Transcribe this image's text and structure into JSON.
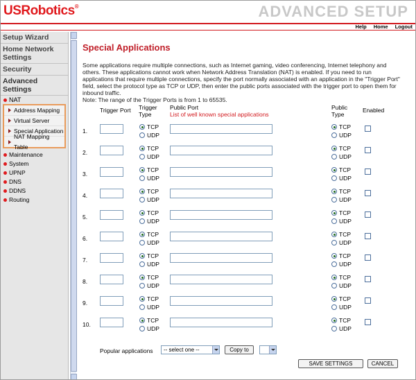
{
  "header": {
    "logo": "USRobotics",
    "logo_mark": "®",
    "title": "ADVANCED SETUP",
    "links": [
      "Help",
      "Home",
      "Logout"
    ]
  },
  "sidebar": {
    "sections": [
      "Setup Wizard",
      "Home Network Settings",
      "Security",
      "Advanced Settings"
    ],
    "nat_label": "NAT",
    "nat_items": [
      "Address Mapping",
      "Virtual Server",
      "Special Application",
      "NAT Mapping Table"
    ],
    "items": [
      "Maintenance",
      "System",
      "UPNP",
      "DNS",
      "DDNS",
      "Routing"
    ]
  },
  "main": {
    "title": "Special Applications",
    "description": "Some applications require multiple connections, such as Internet gaming, video conferencing, Internet telephony and others. These applications cannot work when Network Address Translation (NAT) is enabled. If you need to run applications that require multiple connections, specify the port normally associated with an application in the \"Trigger Port\" field, select the protocol type as TCP or UDP, then enter the public ports associated with the trigger port to open them for inbound traffic.",
    "note": "Note: The range of the Trigger Ports is from 1 to 65535.",
    "headers": {
      "trigger_port": "Trigger Port",
      "trigger_type": "Trigger Type",
      "public_port": "Public Port",
      "well_known": "List of well known special applications",
      "public_type": "Public Type",
      "enabled": "Enabled"
    },
    "rows": [
      {
        "num": "1."
      },
      {
        "num": "2."
      },
      {
        "num": "3."
      },
      {
        "num": "4."
      },
      {
        "num": "5."
      },
      {
        "num": "6."
      },
      {
        "num": "7."
      },
      {
        "num": "8."
      },
      {
        "num": "9."
      },
      {
        "num": "10."
      }
    ],
    "protocols": {
      "tcp": "TCP",
      "udp": "UDP"
    },
    "popular_label": "Popular applications",
    "popular_select": "-- select one --",
    "copy_to": "Copy to",
    "copy_target": "",
    "save": "SAVE SETTINGS",
    "cancel": "CANCEL"
  }
}
